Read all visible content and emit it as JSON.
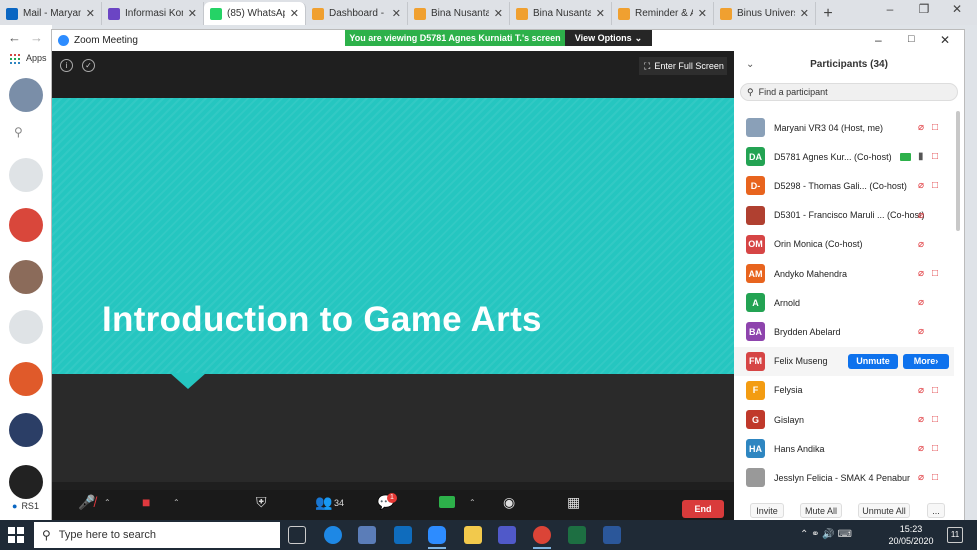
{
  "browser": {
    "tabs": [
      {
        "label": "Mail - Maryani",
        "color": "#0a66c2",
        "active": false
      },
      {
        "label": "Informasi Kon",
        "color": "#6b45c4",
        "active": false
      },
      {
        "label": "(85) WhatsApp",
        "color": "#25d366",
        "active": true
      },
      {
        "label": "Dashboard - I",
        "color": "#f0a030",
        "active": false
      },
      {
        "label": "Bina Nusantar",
        "color": "#f0a030",
        "active": false
      },
      {
        "label": "Bina Nusantar",
        "color": "#f0a030",
        "active": false
      },
      {
        "label": "Reminder & A",
        "color": "#f0a030",
        "active": false
      },
      {
        "label": "Binus Universit",
        "color": "#f0a030",
        "active": false
      }
    ],
    "apps_label": "Apps"
  },
  "zoom": {
    "window_title": "Zoom Meeting",
    "viewing_banner": "You are viewing D5781 Agnes Kurniati T.'s screen",
    "view_options": "View Options",
    "enter_full_screen": "Enter Full Screen",
    "slide_title": "Introduction to Game Arts",
    "toolbar": {
      "participants_count": "34",
      "chat_badge": "1",
      "end_label": "End"
    },
    "participants": {
      "header": "Participants (34)",
      "search_placeholder": "Find a participant",
      "list": [
        {
          "initials": "",
          "name": "Maryani VR3 04 (Host, me)",
          "color": "#8aa0b8"
        },
        {
          "initials": "DA",
          "name": "D5781 Agnes Kur...  (Co-host)",
          "color": "#23a353"
        },
        {
          "initials": "D-",
          "name": "D5298 - Thomas Gali...  (Co-host)",
          "color": "#e8641e"
        },
        {
          "initials": "",
          "name": "D5301 - Francisco Maruli ...  (Co-host)",
          "color": "#b04030"
        },
        {
          "initials": "OM",
          "name": "Orin Monica (Co-host)",
          "color": "#d64545"
        },
        {
          "initials": "AM",
          "name": "Andyko Mahendra",
          "color": "#e8641e"
        },
        {
          "initials": "A",
          "name": "Arnold",
          "color": "#23a353"
        },
        {
          "initials": "BA",
          "name": "Brydden Abelard",
          "color": "#8e44ad"
        },
        {
          "initials": "FM",
          "name": "Felix Museng",
          "color": "#d64545"
        },
        {
          "initials": "F",
          "name": "Felysia",
          "color": "#f39c12"
        },
        {
          "initials": "G",
          "name": "Gislayn",
          "color": "#c0392b"
        },
        {
          "initials": "HA",
          "name": "Hans Andika",
          "color": "#2e86c1"
        },
        {
          "initials": "",
          "name": "Jesslyn Felicia - SMAK 4 Penabur",
          "color": "#999999"
        }
      ],
      "unmute_label": "Unmute",
      "more_label": "More",
      "footer": {
        "invite": "Invite",
        "mute_all": "Mute All",
        "unmute_all": "Unmute All",
        "more": "..."
      }
    }
  },
  "left_strip": {
    "rs_label": "RS1"
  },
  "taskbar": {
    "search_placeholder": "Type here to search",
    "time": "15:23",
    "date": "20/05/2020",
    "notification_count": "11"
  }
}
